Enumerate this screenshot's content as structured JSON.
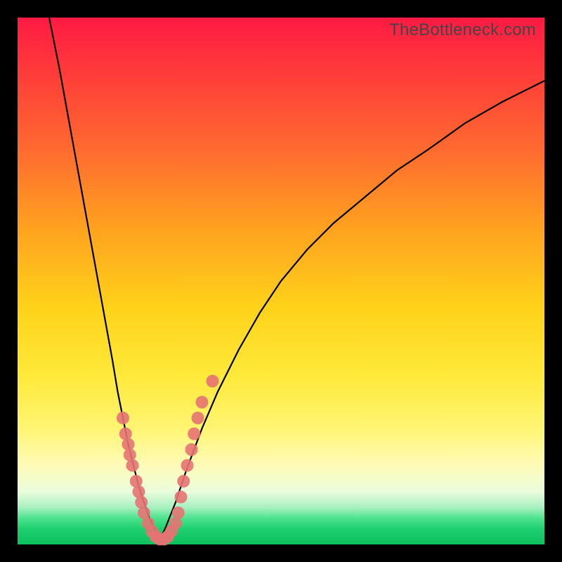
{
  "watermark": "TheBottleneck.com",
  "colors": {
    "frame_bg_top": "#ff1a44",
    "frame_bg_bottom": "#0cc05e",
    "curve": "#000000",
    "dots": "#e57373",
    "page_bg": "#000000"
  },
  "chart_data": {
    "type": "line",
    "title": "",
    "xlabel": "",
    "ylabel": "",
    "xlim": [
      0,
      100
    ],
    "ylim": [
      0,
      100
    ],
    "series": [
      {
        "name": "bottleneck-curve-left",
        "x": [
          6,
          8,
          10,
          12,
          14,
          16,
          18,
          19,
          20,
          21,
          22,
          23,
          24,
          25,
          26,
          27
        ],
        "values": [
          100,
          90,
          79,
          68,
          57,
          46,
          35,
          29,
          24,
          19,
          15,
          11,
          8,
          5,
          3,
          1
        ]
      },
      {
        "name": "bottleneck-curve-right",
        "x": [
          27,
          28,
          30,
          32,
          35,
          38,
          42,
          46,
          50,
          55,
          60,
          66,
          72,
          78,
          85,
          92,
          100
        ],
        "values": [
          1,
          3,
          8,
          14,
          22,
          29,
          37,
          44,
          50,
          56,
          61,
          66,
          71,
          75,
          80,
          84,
          88
        ]
      }
    ],
    "dots": [
      {
        "x": 20.0,
        "y": 24
      },
      {
        "x": 20.5,
        "y": 21
      },
      {
        "x": 21.0,
        "y": 19
      },
      {
        "x": 21.3,
        "y": 17
      },
      {
        "x": 21.8,
        "y": 15
      },
      {
        "x": 22.5,
        "y": 12
      },
      {
        "x": 23.0,
        "y": 10
      },
      {
        "x": 23.5,
        "y": 8
      },
      {
        "x": 24.0,
        "y": 6
      },
      {
        "x": 24.8,
        "y": 4
      },
      {
        "x": 25.5,
        "y": 2.5
      },
      {
        "x": 26.2,
        "y": 1.5
      },
      {
        "x": 27.0,
        "y": 1
      },
      {
        "x": 27.8,
        "y": 1
      },
      {
        "x": 28.5,
        "y": 1.5
      },
      {
        "x": 29.2,
        "y": 2.5
      },
      {
        "x": 30.0,
        "y": 4
      },
      {
        "x": 30.5,
        "y": 6
      },
      {
        "x": 31.0,
        "y": 9
      },
      {
        "x": 31.5,
        "y": 12
      },
      {
        "x": 32.2,
        "y": 15
      },
      {
        "x": 33.0,
        "y": 18
      },
      {
        "x": 33.5,
        "y": 21
      },
      {
        "x": 34.2,
        "y": 24
      },
      {
        "x": 35.0,
        "y": 27
      },
      {
        "x": 37.0,
        "y": 31
      }
    ]
  }
}
